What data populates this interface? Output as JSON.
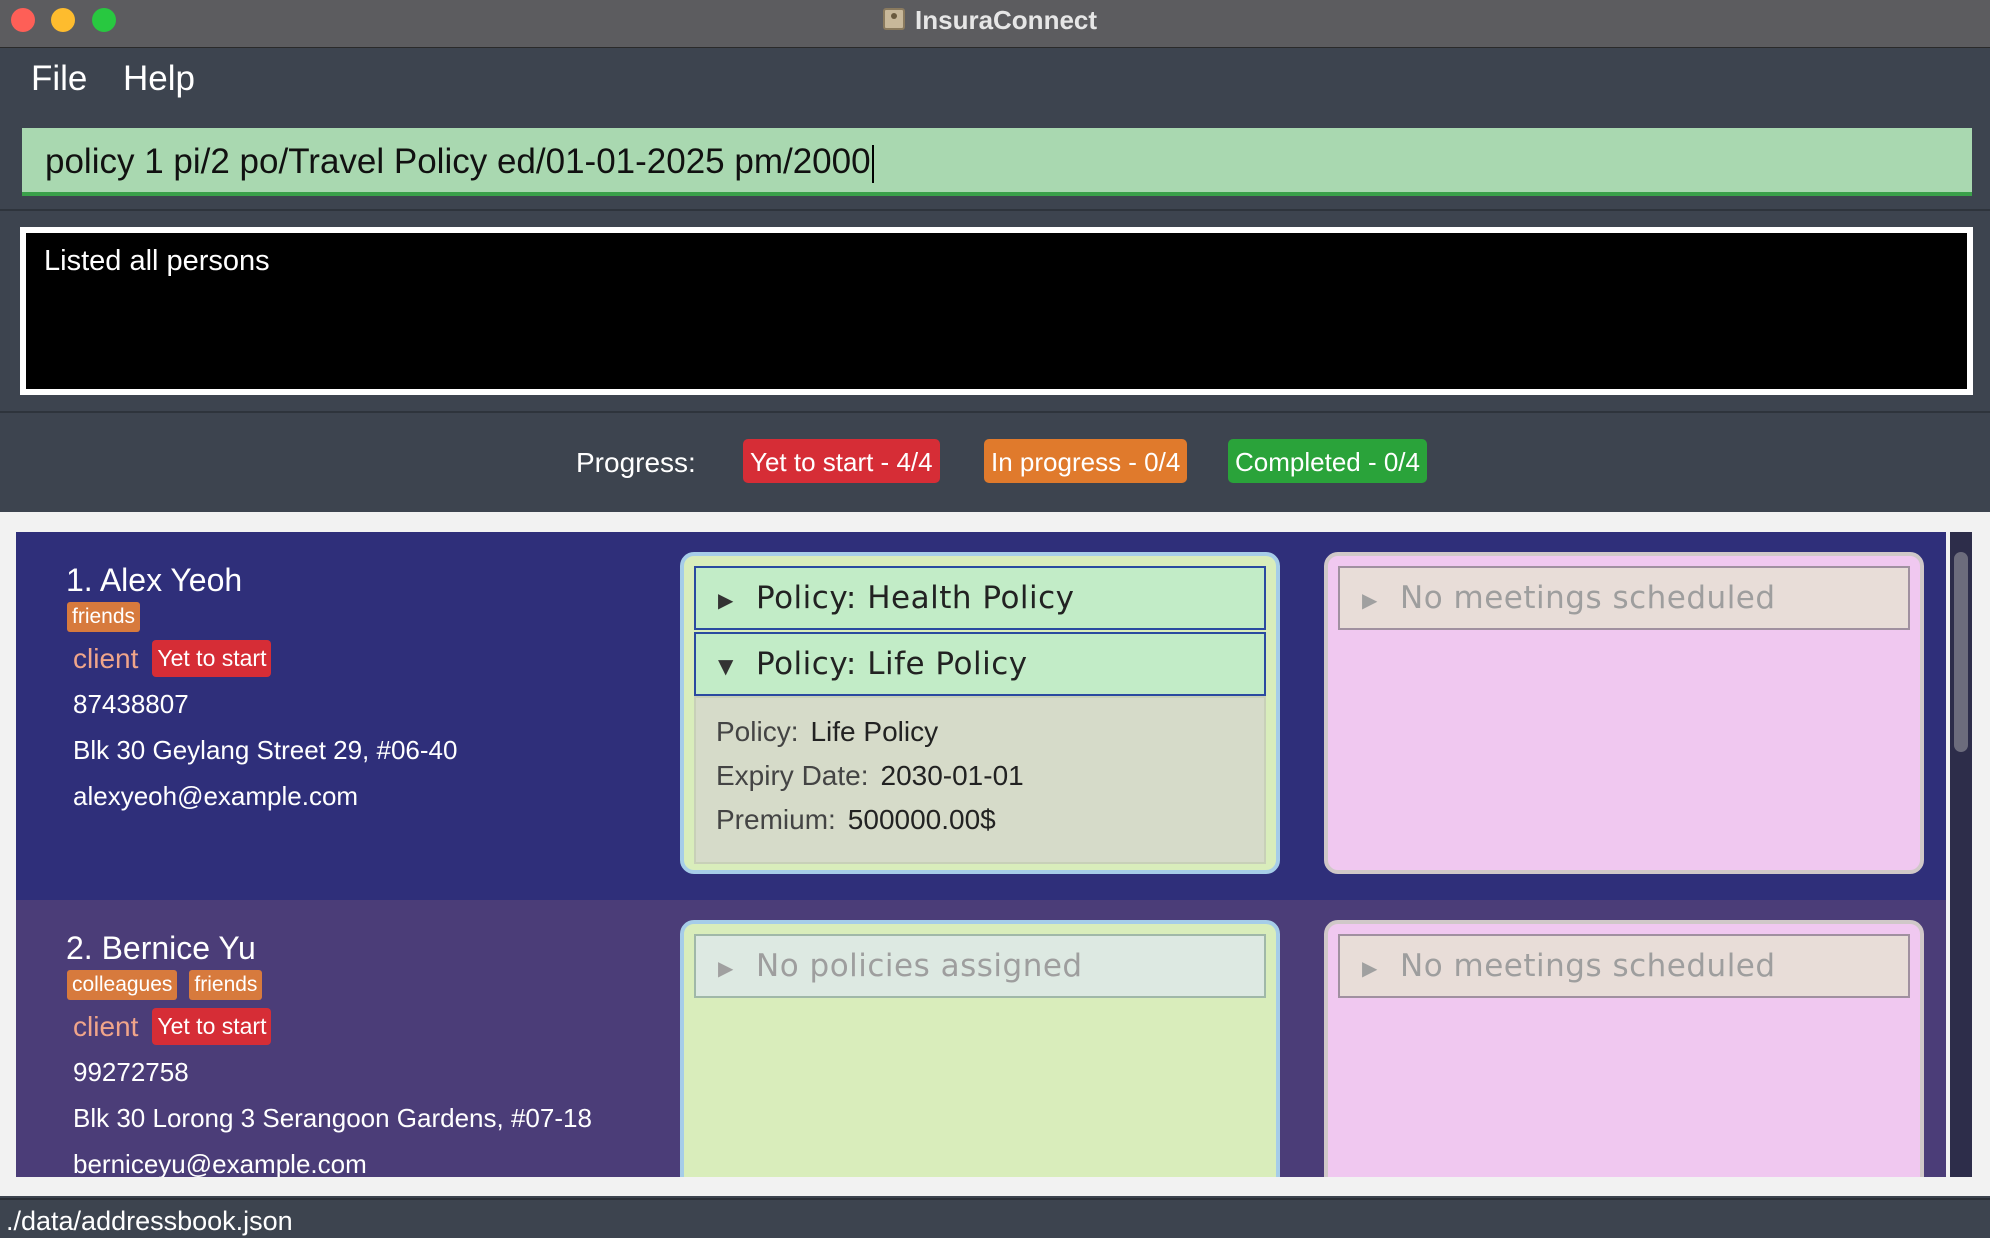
{
  "window": {
    "title": "InsuraConnect"
  },
  "menu": {
    "file_label": "File",
    "help_label": "Help"
  },
  "command": {
    "value": "policy 1 pi/2 po/Travel Policy ed/01-01-2025 pm/2000"
  },
  "result": {
    "text": "Listed all persons"
  },
  "progress": {
    "label": "Progress:",
    "yet_to_start": "Yet to start - 4/4",
    "in_progress": "In progress - 0/4",
    "completed": "Completed - 0/4",
    "colors": {
      "yet_to_start": "#d62d36",
      "in_progress": "#e07a2c",
      "completed": "#2aa33a"
    }
  },
  "persons": [
    {
      "name": "1.  Alex Yeoh",
      "tags": [
        "friends"
      ],
      "role": "client",
      "status": "Yet to start",
      "phone": "87438807",
      "address": "Blk 30 Geylang Street 29, #06-40",
      "email": "alexyeoh@example.com",
      "policies": [
        {
          "title": "Policy: Health Policy",
          "expanded": false
        },
        {
          "title": "Policy: Life Policy",
          "expanded": true,
          "details": {
            "policy_key": "Policy:",
            "policy_value": "Life Policy",
            "expiry_key": "Expiry Date:",
            "expiry_value": "2030-01-01",
            "premium_key": "Premium:",
            "premium_value": "500000.00$"
          }
        }
      ],
      "meetings_text": "No meetings scheduled"
    },
    {
      "name": "2.  Bernice Yu",
      "tags": [
        "colleagues",
        "friends"
      ],
      "role": "client",
      "status": "Yet to start",
      "phone": "99272758",
      "address": "Blk 30 Lorong 3 Serangoon Gardens, #07-18",
      "email": "berniceyu@example.com",
      "policies_text": "No policies assigned",
      "meetings_text": "No meetings scheduled"
    }
  ],
  "footer": {
    "path": "./data/addressbook.json"
  }
}
